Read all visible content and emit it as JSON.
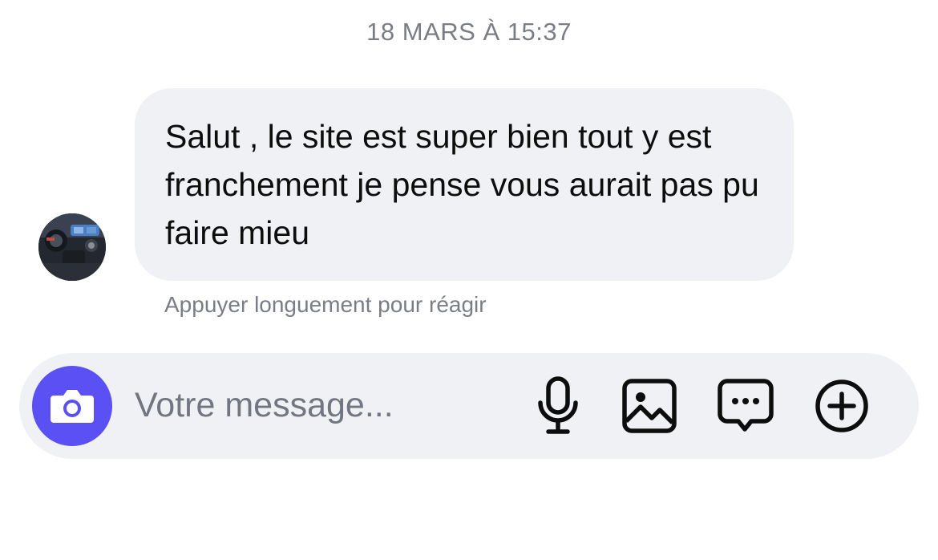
{
  "conversation": {
    "timestamp": "18 MARS À 15:37",
    "messages": [
      {
        "sender": "contact",
        "text": "Salut , le site est super bien tout y est franchement je pense vous aurait pas pu faire mieu"
      }
    ],
    "reaction_hint": "Appuyer longuement pour réagir"
  },
  "composer": {
    "placeholder": "Votre message...",
    "value": "",
    "icons": {
      "camera": "camera-icon",
      "mic": "microphone-icon",
      "gallery": "image-gallery-icon",
      "sticker": "chat-bubble-ellipsis-icon",
      "plus": "plus-circle-icon"
    }
  },
  "colors": {
    "accent": "#5b50f3",
    "bubble": "#eff1f5",
    "muted_text": "#7a7d85"
  }
}
